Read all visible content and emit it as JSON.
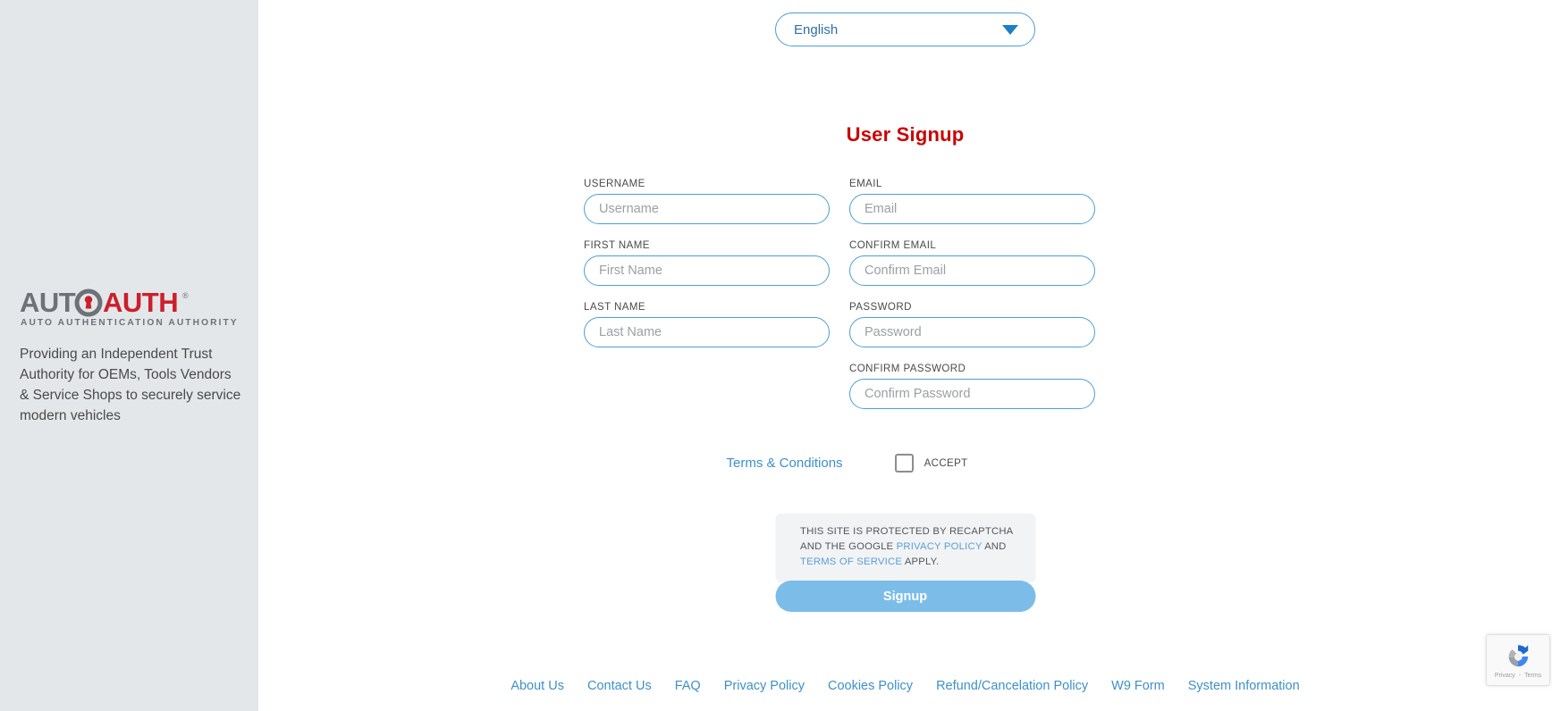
{
  "sidebar": {
    "logo": {
      "icon_name": "autoauth-lock-logo",
      "text_primary_1": "AUTO",
      "text_primary_2": "AUTH",
      "registered_mark": "®",
      "subtitle": "AUTO AUTHENTICATION AUTHORITY",
      "color_gray": "#6d7278",
      "color_red": "#cc1f2b"
    },
    "tagline": "Providing an Independent Trust Authority for OEMs, Tools Vendors & Service Shops to securely service modern vehicles",
    "background": "#e4e7e9"
  },
  "language_select": {
    "name": "language-selector",
    "value": "English",
    "options": [
      "English"
    ],
    "caret_icon": "chevron-down-icon"
  },
  "page": {
    "title": "User Signup",
    "title_color": "#cc0000"
  },
  "form": {
    "fields": [
      {
        "id": "username",
        "label": "USERNAME",
        "placeholder": "Username",
        "value": "",
        "type": "text",
        "column": "left"
      },
      {
        "id": "email",
        "label": "EMAIL",
        "placeholder": "Email",
        "value": "",
        "type": "email",
        "column": "right"
      },
      {
        "id": "first_name",
        "label": "FIRST NAME",
        "placeholder": "First Name",
        "value": "",
        "type": "text",
        "column": "left"
      },
      {
        "id": "confirm_email",
        "label": "CONFIRM EMAIL",
        "placeholder": "Confirm Email",
        "value": "",
        "type": "email",
        "column": "right"
      },
      {
        "id": "last_name",
        "label": "LAST NAME",
        "placeholder": "Last Name",
        "value": "",
        "type": "text",
        "column": "left"
      },
      {
        "id": "password",
        "label": "PASSWORD",
        "placeholder": "Password",
        "value": "",
        "type": "password",
        "column": "right"
      },
      {
        "id": "confirm_password",
        "label": "CONFIRM PASSWORD",
        "placeholder": "Confirm Password",
        "value": "",
        "type": "password",
        "column": "right"
      }
    ]
  },
  "terms": {
    "link_label": "Terms & Conditions",
    "accept_label": "ACCEPT",
    "checkbox_checked": false
  },
  "recaptcha_notice": {
    "text_1": "THIS SITE IS PROTECTED BY RECAPTCHA AND THE GOOGLE ",
    "link_privacy": "PRIVACY POLICY",
    "text_2": " AND ",
    "link_terms": "TERMS OF SERVICE",
    "text_3": " APPLY."
  },
  "submit": {
    "label": "Signup",
    "color": "#7bbde8"
  },
  "footer": {
    "links": [
      "About Us",
      "Contact Us",
      "FAQ",
      "Privacy Policy",
      "Cookies Policy",
      "Refund/Cancelation Policy",
      "W9 Form",
      "System Information"
    ]
  },
  "recaptcha_badge": {
    "icon_name": "recaptcha-icon",
    "privacy_label": "Privacy",
    "terms_label": "Terms",
    "separator": "-"
  }
}
